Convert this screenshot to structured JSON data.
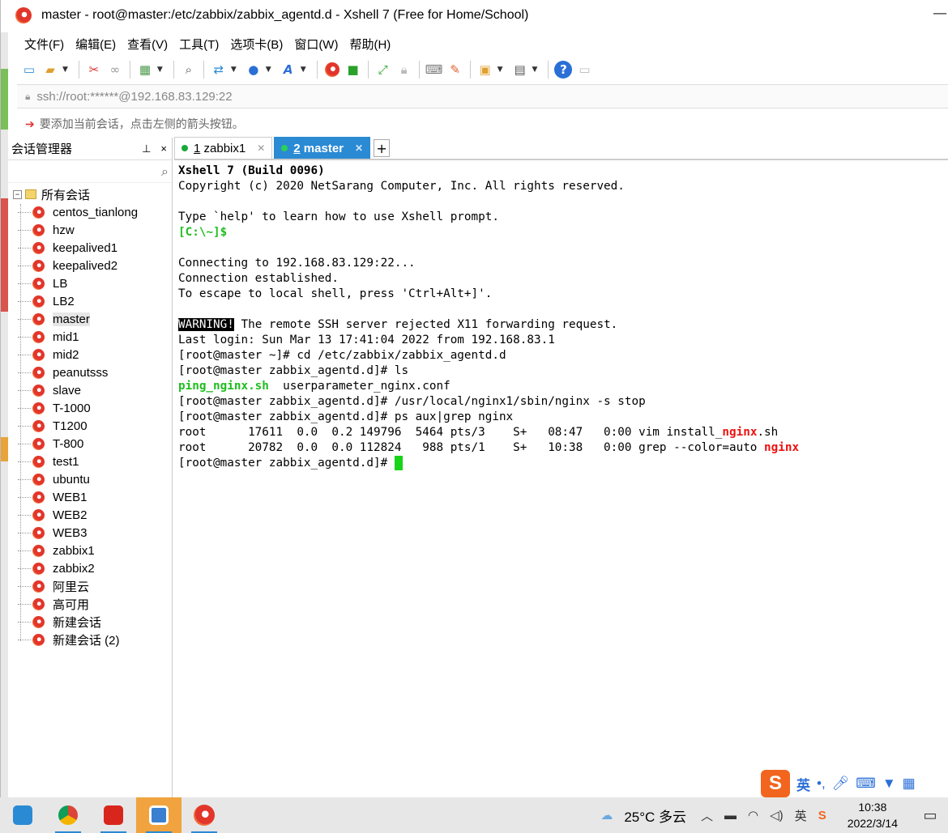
{
  "window": {
    "title": "master - root@master:/etc/zabbix/zabbix_agentd.d - Xshell 7 (Free for Home/School)"
  },
  "menu": [
    "文件(F)",
    "编辑(E)",
    "查看(V)",
    "工具(T)",
    "选项卡(B)",
    "窗口(W)",
    "帮助(H)"
  ],
  "toolbar": {
    "icons": [
      "new-session-icon",
      "open-folder-icon",
      "disconnect-icon",
      "reconnect-icon",
      "properties-icon",
      "find-icon",
      "transfer-icon",
      "globe-icon",
      "font-icon",
      "xshell-logo-icon",
      "xftp-icon",
      "fullscreen-icon",
      "lock-icon",
      "keyboard-icon",
      "highlight-icon",
      "compose-icon",
      "layout-icon",
      "help-icon",
      "chat-icon"
    ]
  },
  "address": {
    "value": "ssh://root:******@192.168.83.129:22"
  },
  "hint": {
    "text": "要添加当前会话，点击左侧的箭头按钮。"
  },
  "session_manager": {
    "title": "会话管理器",
    "pin": "ᵖ",
    "close": "×",
    "root": "所有会话",
    "items": [
      "centos_tianlong",
      "hzw",
      "keepalived1",
      "keepalived2",
      "LB",
      "LB2",
      "master",
      "mid1",
      "mid2",
      "peanutsss",
      "slave",
      "T-1000",
      "T1200",
      "T-800",
      "test1",
      "ubuntu",
      "WEB1",
      "WEB2",
      "WEB3",
      "zabbix1",
      "zabbix2",
      "阿里云",
      "高可用",
      "新建会话",
      "新建会话 (2)"
    ],
    "selected": "master"
  },
  "tabs": [
    {
      "num": "1",
      "label": "zabbix1",
      "active": false
    },
    {
      "num": "2",
      "label": "master",
      "active": true
    }
  ],
  "terminal": {
    "l1": "Xshell 7 (Build 0096)",
    "l2": "Copyright (c) 2020 NetSarang Computer, Inc. All rights reserved.",
    "l3": "Type `help' to learn how to use Xshell prompt.",
    "l4": "[C:\\~]$",
    "l5": "Connecting to 192.168.83.129:22...",
    "l6": "Connection established.",
    "l7": "To escape to local shell, press 'Ctrl+Alt+]'.",
    "l8a": "WARNING!",
    "l8b": " The remote SSH server rejected X11 forwarding request.",
    "l9": "Last login: Sun Mar 13 17:41:04 2022 from 192.168.83.1",
    "l10": "[root@master ~]# cd /etc/zabbix/zabbix_agentd.d",
    "l11": "[root@master zabbix_agentd.d]# ls",
    "l12a": "ping_nginx.sh",
    "l12b": "  userparameter_nginx.conf",
    "l13": "[root@master zabbix_agentd.d]# /usr/local/nginx1/sbin/nginx -s stop",
    "l14": "[root@master zabbix_agentd.d]# ps aux|grep nginx",
    "l15a": "root      17611  0.0  0.2 149796  5464 pts/3    S+   08:47   0:00 vim install_",
    "l15b": "nginx",
    "l15c": ".sh",
    "l16a": "root      20782  0.0  0.0 112824   988 pts/1    S+   10:38   0:00 grep --color=auto ",
    "l16b": "nginx",
    "l17": "[root@master zabbix_agentd.d]# "
  },
  "ime": {
    "logo": "S",
    "lang": "英",
    "punct": "•,",
    "icons": [
      "mic-icon",
      "keyboard-icon",
      "shirt-icon",
      "grid-icon"
    ]
  },
  "taskbar": {
    "weather": "25°C  多云",
    "tray_lang": "英",
    "time": "10:38",
    "date": "2022/3/14"
  },
  "colors": {
    "accent": "#2a8ad4",
    "prompt_green": "#1fbd1f",
    "match_red": "#e11111",
    "cursor": "#18d418"
  }
}
